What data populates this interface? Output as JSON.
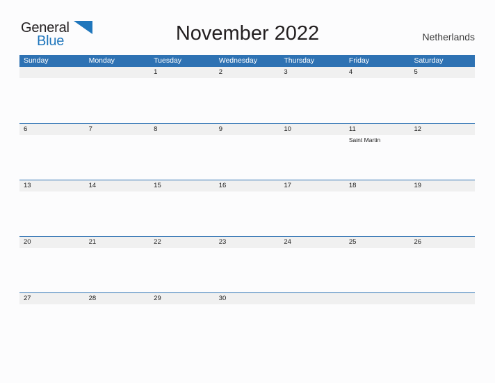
{
  "brand": {
    "name_part1": "General",
    "name_part2": "Blue",
    "flag_icon": "blue-flag-triangle-icon",
    "dark_color": "#231f20",
    "blue_color": "#1f76bc"
  },
  "header": {
    "title": "November 2022",
    "country": "Netherlands"
  },
  "theme": {
    "header_blue": "#2e72b3",
    "band_gray": "#f0f0f0",
    "page_background": "#fcfcfd",
    "text_color": "#1c1c1c"
  },
  "calendar": {
    "month": "November",
    "year": "2022",
    "weekdays": [
      "Sunday",
      "Monday",
      "Tuesday",
      "Wednesday",
      "Thursday",
      "Friday",
      "Saturday"
    ],
    "weeks": [
      {
        "days": [
          {
            "date": "",
            "events": []
          },
          {
            "date": "",
            "events": []
          },
          {
            "date": "1",
            "events": []
          },
          {
            "date": "2",
            "events": []
          },
          {
            "date": "3",
            "events": []
          },
          {
            "date": "4",
            "events": []
          },
          {
            "date": "5",
            "events": []
          }
        ]
      },
      {
        "days": [
          {
            "date": "6",
            "events": []
          },
          {
            "date": "7",
            "events": []
          },
          {
            "date": "8",
            "events": []
          },
          {
            "date": "9",
            "events": []
          },
          {
            "date": "10",
            "events": []
          },
          {
            "date": "11",
            "events": [
              "Saint Martin"
            ]
          },
          {
            "date": "12",
            "events": []
          }
        ]
      },
      {
        "days": [
          {
            "date": "13",
            "events": []
          },
          {
            "date": "14",
            "events": []
          },
          {
            "date": "15",
            "events": []
          },
          {
            "date": "16",
            "events": []
          },
          {
            "date": "17",
            "events": []
          },
          {
            "date": "18",
            "events": []
          },
          {
            "date": "19",
            "events": []
          }
        ]
      },
      {
        "days": [
          {
            "date": "20",
            "events": []
          },
          {
            "date": "21",
            "events": []
          },
          {
            "date": "22",
            "events": []
          },
          {
            "date": "23",
            "events": []
          },
          {
            "date": "24",
            "events": []
          },
          {
            "date": "25",
            "events": []
          },
          {
            "date": "26",
            "events": []
          }
        ]
      },
      {
        "days": [
          {
            "date": "27",
            "events": []
          },
          {
            "date": "28",
            "events": []
          },
          {
            "date": "29",
            "events": []
          },
          {
            "date": "30",
            "events": []
          },
          {
            "date": "",
            "events": []
          },
          {
            "date": "",
            "events": []
          },
          {
            "date": "",
            "events": []
          }
        ]
      }
    ]
  }
}
